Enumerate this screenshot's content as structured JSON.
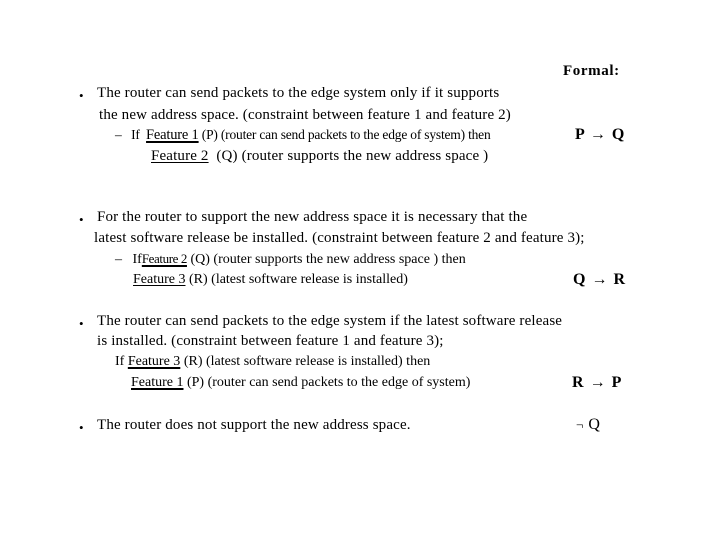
{
  "formal_header": "Formal:",
  "bullet_glyph": "•",
  "dash_glyph": "–",
  "constraints": [
    {
      "statement_line1": "The router can send packets to the edge system only if it supports",
      "statement_line2": "the new address space. (constraint between feature 1 and feature 2)",
      "if_prefix": "If",
      "if_feature": "Feature 1",
      "if_symbol": "(P)",
      "if_desc": "(router can send packets to the edge of system) then",
      "then_feature": "Feature 2",
      "then_symbol": "(Q)",
      "then_desc": "(router supports the new address space )",
      "formal": {
        "left": "P",
        "op": "→",
        "right": "Q"
      }
    },
    {
      "statement_line1": "For the router to support the new address space it is necessary that the",
      "statement_line2": "latest software release be installed. (constraint between feature 2 and feature 3);",
      "if_prefix": "If",
      "if_feature": "Feature 2",
      "if_symbol": "(Q)",
      "if_desc": "(router supports the new address space ) then",
      "then_feature": "Feature 3",
      "then_symbol": "(R)",
      "then_desc": "(latest software release is installed)",
      "formal": {
        "left": "Q",
        "op": "→",
        "right": "R"
      }
    },
    {
      "statement_line1": "The router can send packets to the edge system if the latest software release",
      "statement_line2": "is installed. (constraint between feature 1 and feature 3);",
      "if_prefix": "If",
      "if_feature": "Feature 3",
      "if_symbol": "(R)",
      "if_desc": "(latest software release is installed) then",
      "then_feature": "Feature 1",
      "then_symbol": "(P)",
      "then_desc": "(router can send packets to the edge of system)",
      "formal": {
        "left": "R",
        "op": "→",
        "right": "P"
      }
    },
    {
      "statement_line1": "The router does not support the new address space.",
      "formal": {
        "neg": "¬",
        "right": "Q"
      }
    }
  ]
}
